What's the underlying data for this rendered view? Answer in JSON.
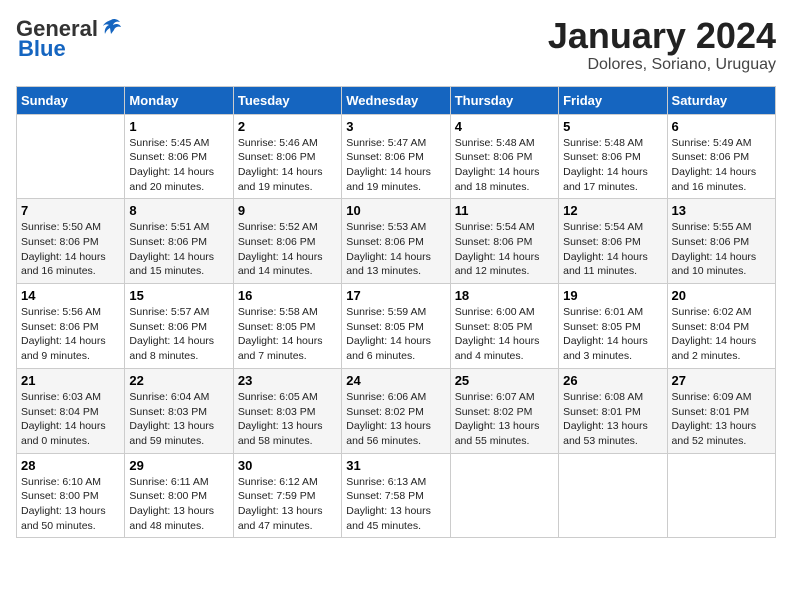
{
  "logo": {
    "general": "General",
    "blue": "Blue"
  },
  "title": "January 2024",
  "subtitle": "Dolores, Soriano, Uruguay",
  "days_of_week": [
    "Sunday",
    "Monday",
    "Tuesday",
    "Wednesday",
    "Thursday",
    "Friday",
    "Saturday"
  ],
  "weeks": [
    [
      {
        "day": "",
        "info": ""
      },
      {
        "day": "1",
        "info": "Sunrise: 5:45 AM\nSunset: 8:06 PM\nDaylight: 14 hours\nand 20 minutes."
      },
      {
        "day": "2",
        "info": "Sunrise: 5:46 AM\nSunset: 8:06 PM\nDaylight: 14 hours\nand 19 minutes."
      },
      {
        "day": "3",
        "info": "Sunrise: 5:47 AM\nSunset: 8:06 PM\nDaylight: 14 hours\nand 19 minutes."
      },
      {
        "day": "4",
        "info": "Sunrise: 5:48 AM\nSunset: 8:06 PM\nDaylight: 14 hours\nand 18 minutes."
      },
      {
        "day": "5",
        "info": "Sunrise: 5:48 AM\nSunset: 8:06 PM\nDaylight: 14 hours\nand 17 minutes."
      },
      {
        "day": "6",
        "info": "Sunrise: 5:49 AM\nSunset: 8:06 PM\nDaylight: 14 hours\nand 16 minutes."
      }
    ],
    [
      {
        "day": "7",
        "info": "Sunrise: 5:50 AM\nSunset: 8:06 PM\nDaylight: 14 hours\nand 16 minutes."
      },
      {
        "day": "8",
        "info": "Sunrise: 5:51 AM\nSunset: 8:06 PM\nDaylight: 14 hours\nand 15 minutes."
      },
      {
        "day": "9",
        "info": "Sunrise: 5:52 AM\nSunset: 8:06 PM\nDaylight: 14 hours\nand 14 minutes."
      },
      {
        "day": "10",
        "info": "Sunrise: 5:53 AM\nSunset: 8:06 PM\nDaylight: 14 hours\nand 13 minutes."
      },
      {
        "day": "11",
        "info": "Sunrise: 5:54 AM\nSunset: 8:06 PM\nDaylight: 14 hours\nand 12 minutes."
      },
      {
        "day": "12",
        "info": "Sunrise: 5:54 AM\nSunset: 8:06 PM\nDaylight: 14 hours\nand 11 minutes."
      },
      {
        "day": "13",
        "info": "Sunrise: 5:55 AM\nSunset: 8:06 PM\nDaylight: 14 hours\nand 10 minutes."
      }
    ],
    [
      {
        "day": "14",
        "info": "Sunrise: 5:56 AM\nSunset: 8:06 PM\nDaylight: 14 hours\nand 9 minutes."
      },
      {
        "day": "15",
        "info": "Sunrise: 5:57 AM\nSunset: 8:06 PM\nDaylight: 14 hours\nand 8 minutes."
      },
      {
        "day": "16",
        "info": "Sunrise: 5:58 AM\nSunset: 8:05 PM\nDaylight: 14 hours\nand 7 minutes."
      },
      {
        "day": "17",
        "info": "Sunrise: 5:59 AM\nSunset: 8:05 PM\nDaylight: 14 hours\nand 6 minutes."
      },
      {
        "day": "18",
        "info": "Sunrise: 6:00 AM\nSunset: 8:05 PM\nDaylight: 14 hours\nand 4 minutes."
      },
      {
        "day": "19",
        "info": "Sunrise: 6:01 AM\nSunset: 8:05 PM\nDaylight: 14 hours\nand 3 minutes."
      },
      {
        "day": "20",
        "info": "Sunrise: 6:02 AM\nSunset: 8:04 PM\nDaylight: 14 hours\nand 2 minutes."
      }
    ],
    [
      {
        "day": "21",
        "info": "Sunrise: 6:03 AM\nSunset: 8:04 PM\nDaylight: 14 hours\nand 0 minutes."
      },
      {
        "day": "22",
        "info": "Sunrise: 6:04 AM\nSunset: 8:03 PM\nDaylight: 13 hours\nand 59 minutes."
      },
      {
        "day": "23",
        "info": "Sunrise: 6:05 AM\nSunset: 8:03 PM\nDaylight: 13 hours\nand 58 minutes."
      },
      {
        "day": "24",
        "info": "Sunrise: 6:06 AM\nSunset: 8:02 PM\nDaylight: 13 hours\nand 56 minutes."
      },
      {
        "day": "25",
        "info": "Sunrise: 6:07 AM\nSunset: 8:02 PM\nDaylight: 13 hours\nand 55 minutes."
      },
      {
        "day": "26",
        "info": "Sunrise: 6:08 AM\nSunset: 8:01 PM\nDaylight: 13 hours\nand 53 minutes."
      },
      {
        "day": "27",
        "info": "Sunrise: 6:09 AM\nSunset: 8:01 PM\nDaylight: 13 hours\nand 52 minutes."
      }
    ],
    [
      {
        "day": "28",
        "info": "Sunrise: 6:10 AM\nSunset: 8:00 PM\nDaylight: 13 hours\nand 50 minutes."
      },
      {
        "day": "29",
        "info": "Sunrise: 6:11 AM\nSunset: 8:00 PM\nDaylight: 13 hours\nand 48 minutes."
      },
      {
        "day": "30",
        "info": "Sunrise: 6:12 AM\nSunset: 7:59 PM\nDaylight: 13 hours\nand 47 minutes."
      },
      {
        "day": "31",
        "info": "Sunrise: 6:13 AM\nSunset: 7:58 PM\nDaylight: 13 hours\nand 45 minutes."
      },
      {
        "day": "",
        "info": ""
      },
      {
        "day": "",
        "info": ""
      },
      {
        "day": "",
        "info": ""
      }
    ]
  ]
}
